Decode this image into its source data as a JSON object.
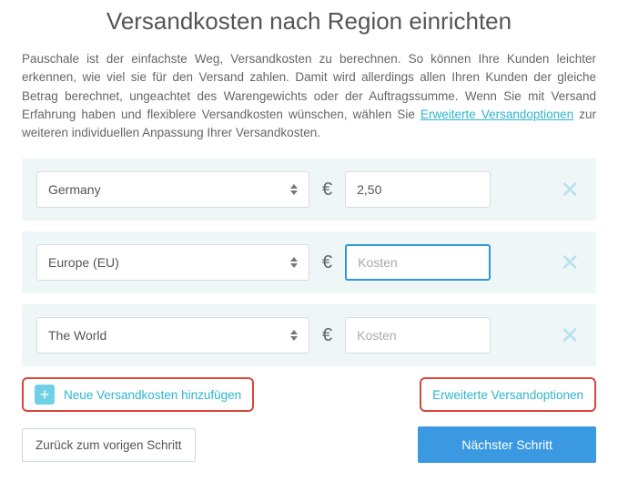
{
  "title": "Versandkosten nach Region einrichten",
  "intro": {
    "p1": "Pauschale ist der einfachste Weg, Versandkosten zu berechnen. So können Ihre Kunden leichter erkennen, wie viel sie für den Versand zahlen. Damit wird allerdings allen Ihren Kunden der gleiche Betrag berechnet, ungeachtet des Warengewichts oder der Auftragssumme. Wenn Sie mit Versand Erfahrung haben und flexiblere Versandkosten wünschen, wählen Sie ",
    "link_text": "Erweiterte Versandoptionen",
    "p2": " zur weiteren individuellen Anpassung Ihrer Versandkosten."
  },
  "rows": [
    {
      "region": "Germany",
      "currency": "€",
      "cost": "2,50",
      "placeholder": "Kosten",
      "active": false
    },
    {
      "region": "Europe (EU)",
      "currency": "€",
      "cost": "",
      "placeholder": "Kosten",
      "active": true
    },
    {
      "region": "The World",
      "currency": "€",
      "cost": "",
      "placeholder": "Kosten",
      "active": false
    }
  ],
  "actions": {
    "add_label": "Neue Versandkosten hinzufügen",
    "advanced_label": "Erweiterte Versandoptionen"
  },
  "footer": {
    "back_label": "Zurück zum vorigen Schritt",
    "next_label": "Nächster Schritt"
  }
}
